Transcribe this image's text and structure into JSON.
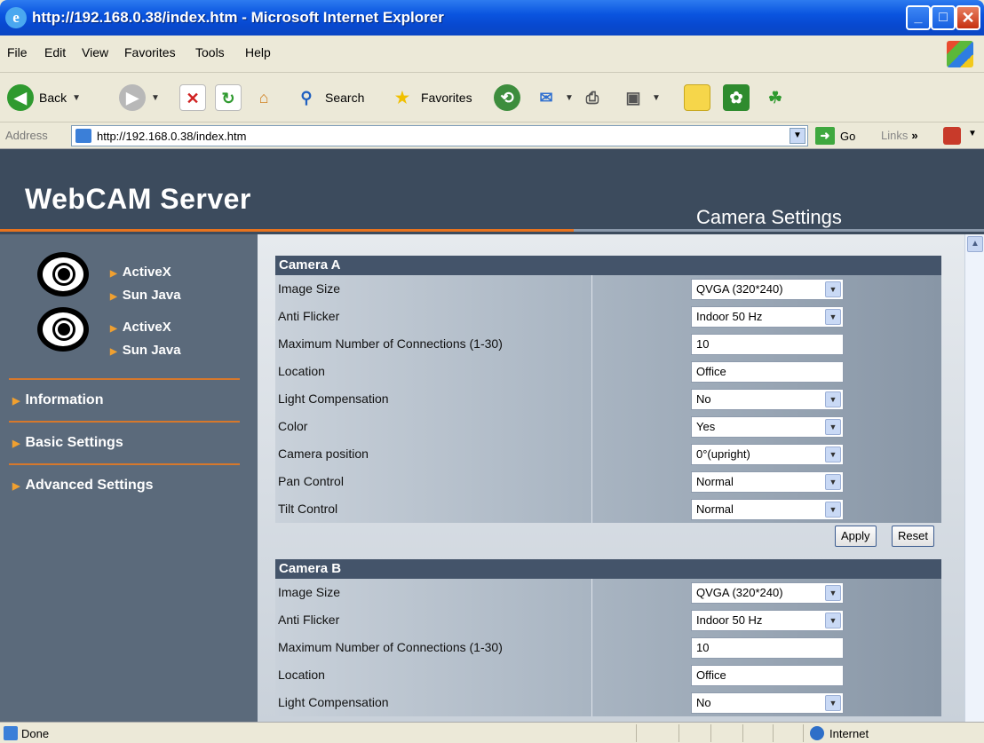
{
  "window": {
    "title": "http://192.168.0.38/index.htm - Microsoft Internet Explorer"
  },
  "menu": [
    "File",
    "Edit",
    "View",
    "Favorites",
    "Tools",
    "Help"
  ],
  "toolbar": {
    "back": "Back",
    "search": "Search",
    "favorites": "Favorites"
  },
  "address": {
    "label": "Address",
    "url": "http://192.168.0.38/index.htm",
    "go": "Go",
    "links": "Links"
  },
  "header": {
    "brand": "WebCAM Server",
    "section": "Camera Settings"
  },
  "sidebar": {
    "cam1_links": [
      "ActiveX",
      "Sun Java"
    ],
    "cam2_links": [
      "ActiveX",
      "Sun Java"
    ],
    "nav": [
      "Information",
      "Basic Settings",
      "Advanced Settings"
    ]
  },
  "camera_a": {
    "title": "Camera A",
    "image_size": {
      "label": "Image Size",
      "value": "QVGA (320*240)"
    },
    "anti_flicker": {
      "label": "Anti Flicker",
      "value": "Indoor 50 Hz"
    },
    "max_connections": {
      "label": "Maximum Number of Connections (1-30)",
      "value": "10"
    },
    "location": {
      "label": "Location",
      "value": "Office"
    },
    "light_comp": {
      "label": "Light Compensation",
      "value": "No"
    },
    "color": {
      "label": "Color",
      "value": "Yes"
    },
    "position": {
      "label": "Camera position",
      "value": "0°(upright)"
    },
    "pan": {
      "label": "Pan Control",
      "value": "Normal"
    },
    "tilt": {
      "label": "Tilt Control",
      "value": "Normal"
    },
    "apply": "Apply",
    "reset": "Reset"
  },
  "camera_b": {
    "title": "Camera B",
    "image_size": {
      "label": "Image Size",
      "value": "QVGA (320*240)"
    },
    "anti_flicker": {
      "label": "Anti Flicker",
      "value": "Indoor 50 Hz"
    },
    "max_connections": {
      "label": "Maximum Number of Connections (1-30)",
      "value": "10"
    },
    "location": {
      "label": "Location",
      "value": "Office"
    },
    "light_comp": {
      "label": "Light Compensation",
      "value": "No"
    }
  },
  "status": {
    "text": "Done",
    "zone": "Internet"
  },
  "colors": {
    "header_bg": "#3c4b5d",
    "sidebar_bg": "#5b6a7b",
    "accent": "#e8731e",
    "panel_head": "#44546a"
  }
}
